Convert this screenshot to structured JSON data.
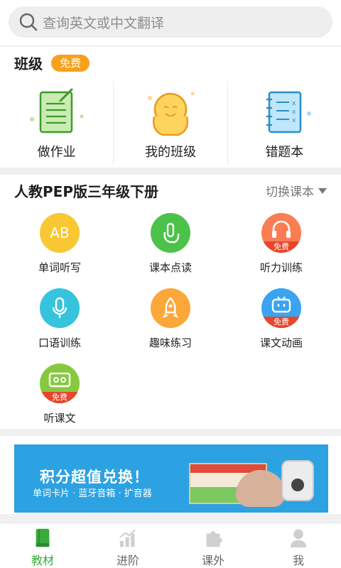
{
  "search": {
    "placeholder": "查询英文或中文翻译"
  },
  "class_section": {
    "title": "班级",
    "badge": "免费",
    "items": [
      {
        "label": "做作业",
        "icon": "homework-icon"
      },
      {
        "label": "我的班级",
        "icon": "my-class-icon"
      },
      {
        "label": "错题本",
        "icon": "mistake-book-icon"
      }
    ]
  },
  "textbook_section": {
    "title": "人教PEP版三年级下册",
    "switch_label": "切换课本",
    "functions": [
      {
        "label": "单词听写",
        "icon": "AB",
        "color": "#f9c733"
      },
      {
        "label": "课本点读",
        "icon": "touch-icon",
        "color": "#4cc24a"
      },
      {
        "label": "听力训练",
        "icon": "headphones-icon",
        "color": "#fb7d54",
        "tag": "免费"
      },
      {
        "label": "口语训练",
        "icon": "microphone-icon",
        "color": "#35c3dd"
      },
      {
        "label": "趣味练习",
        "icon": "rocket-icon",
        "color": "#fba73a"
      },
      {
        "label": "课文动画",
        "icon": "tv-icon",
        "color": "#3aa4f2",
        "tag": "免费"
      },
      {
        "label": "听课文",
        "icon": "cassette-icon",
        "color": "#86c93f",
        "tag": "免费"
      }
    ]
  },
  "banner": {
    "title": "积分超值兑换！",
    "subtitle": "单词卡片 · 蓝牙音箱 · 扩音器",
    "color": "#2ca2e2"
  },
  "tabbar": {
    "active_color": "#3aab3c",
    "tabs": [
      {
        "label": "教材",
        "icon": "book-icon",
        "active": true
      },
      {
        "label": "进阶",
        "icon": "bar-chart-icon",
        "active": false
      },
      {
        "label": "课外",
        "icon": "puzzle-icon",
        "active": false
      },
      {
        "label": "我",
        "icon": "person-icon",
        "active": false
      }
    ]
  }
}
